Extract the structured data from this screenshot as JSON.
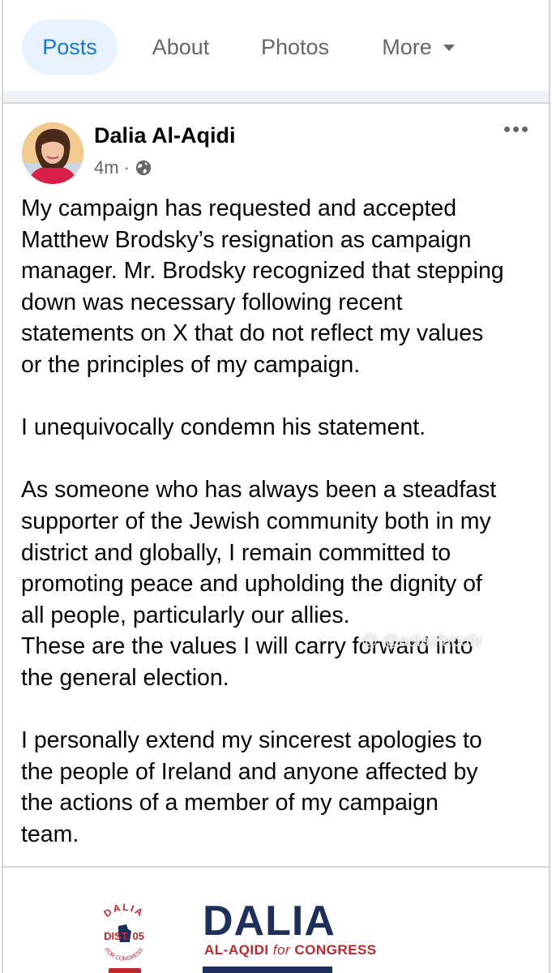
{
  "tabs": [
    {
      "label": "Posts",
      "active": true
    },
    {
      "label": "About",
      "active": false
    },
    {
      "label": "Photos",
      "active": false
    },
    {
      "label": "More",
      "active": false
    }
  ],
  "post": {
    "author": "Dalia Al-Aqidi",
    "time": "4m",
    "separator": "·",
    "privacy_icon": "globe-icon",
    "menu_icon": "more-options-icon",
    "paragraphs": [
      [
        "My campaign has requested and accepted",
        "Matthew Brodsky’s resignation as campaign",
        "manager. Mr. Brodsky recognized that stepping",
        "down was necessary following recent",
        "statements on X that do not reflect my values",
        "or the principles of my campaign."
      ],
      [
        "I unequivocally condemn his statement."
      ],
      [
        "As someone who has always been a steadfast",
        "supporter of the Jewish community both in my",
        "district and globally, I remain committed to",
        "promoting peace and upholding the dignity of",
        "all people, particularly our allies.",
        "These are the values I will carry forward into",
        "the general election."
      ],
      [
        "I personally extend my sincerest apologies to",
        "the people of Ireland and anyone affected by",
        "the actions of a member of my campaign",
        "team."
      ]
    ]
  },
  "watermark": "@ @adlasfabofir",
  "campaign_logo": {
    "name": "DALIA",
    "subtitle_left": "AL-AQIDI ",
    "subtitle_for": "for",
    "subtitle_right": " CONGRESS",
    "seal_top": "DALIA",
    "seal_middle": "DIST. 05",
    "seal_bottom": "FOR CONGRESS"
  },
  "colors": {
    "accent": "#1b74e4",
    "tab_active_bg": "#e7f3ff",
    "muted": "#65676b",
    "logo_navy": "#1f2f5c",
    "logo_red": "#c0272d"
  }
}
